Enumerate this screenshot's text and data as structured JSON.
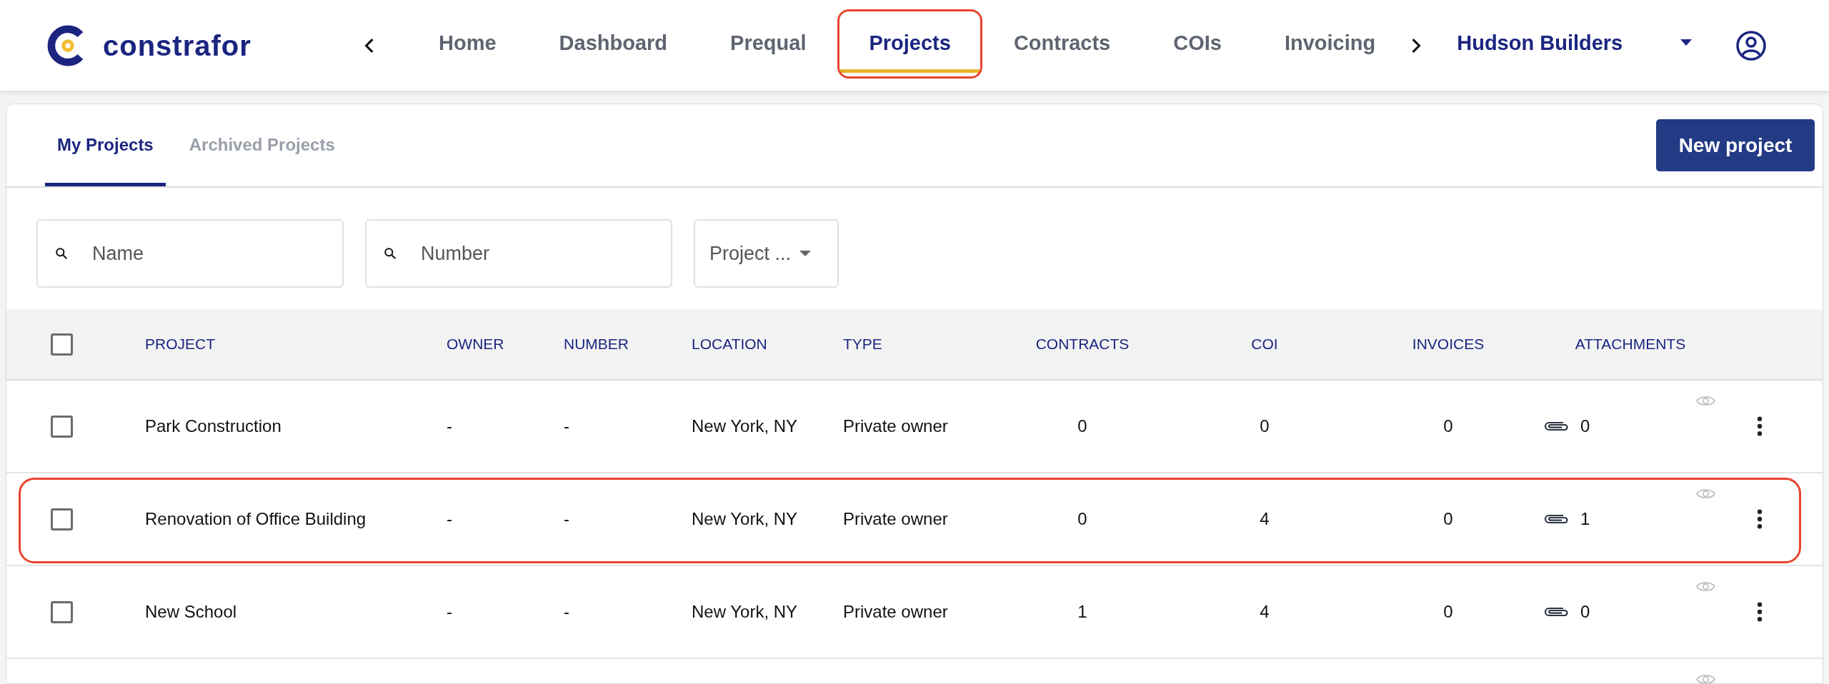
{
  "brand": {
    "name": "constrafor"
  },
  "nav": {
    "items": [
      {
        "label": "Home",
        "selected": false,
        "highlighted": false
      },
      {
        "label": "Dashboard",
        "selected": false,
        "highlighted": false
      },
      {
        "label": "Prequal",
        "selected": false,
        "highlighted": false
      },
      {
        "label": "Projects",
        "selected": true,
        "highlighted": true
      },
      {
        "label": "Contracts",
        "selected": false,
        "highlighted": false
      },
      {
        "label": "COIs",
        "selected": false,
        "highlighted": false
      },
      {
        "label": "Invoicing",
        "selected": false,
        "highlighted": false
      }
    ],
    "company": "Hudson Builders"
  },
  "tabs": [
    {
      "label": "My Projects",
      "selected": true
    },
    {
      "label": "Archived Projects",
      "selected": false
    }
  ],
  "new_project_button": "New project",
  "filters": [
    {
      "kind": "search",
      "placeholder": "Name"
    },
    {
      "kind": "search",
      "placeholder": "Number"
    },
    {
      "kind": "select",
      "value": "Project ..."
    }
  ],
  "table": {
    "select_all_checked": false,
    "columns": [
      "PROJECT",
      "OWNER",
      "NUMBER",
      "LOCATION",
      "TYPE",
      "CONTRACTS",
      "COI",
      "INVOICES",
      "ATTACHMENTS"
    ],
    "rows": [
      {
        "checked": false,
        "highlighted": false,
        "cells": [
          "Park Construction",
          "-",
          "-",
          "New York, NY",
          "Private owner",
          "0",
          "0",
          "0",
          "0"
        ]
      },
      {
        "checked": false,
        "highlighted": true,
        "cells": [
          "Renovation of Office Building",
          "-",
          "-",
          "New York, NY",
          "Private owner",
          "0",
          "4",
          "0",
          "1"
        ]
      },
      {
        "checked": false,
        "highlighted": false,
        "cells": [
          "New School",
          "-",
          "-",
          "New York, NY",
          "Private owner",
          "1",
          "4",
          "0",
          "0"
        ]
      }
    ]
  }
}
